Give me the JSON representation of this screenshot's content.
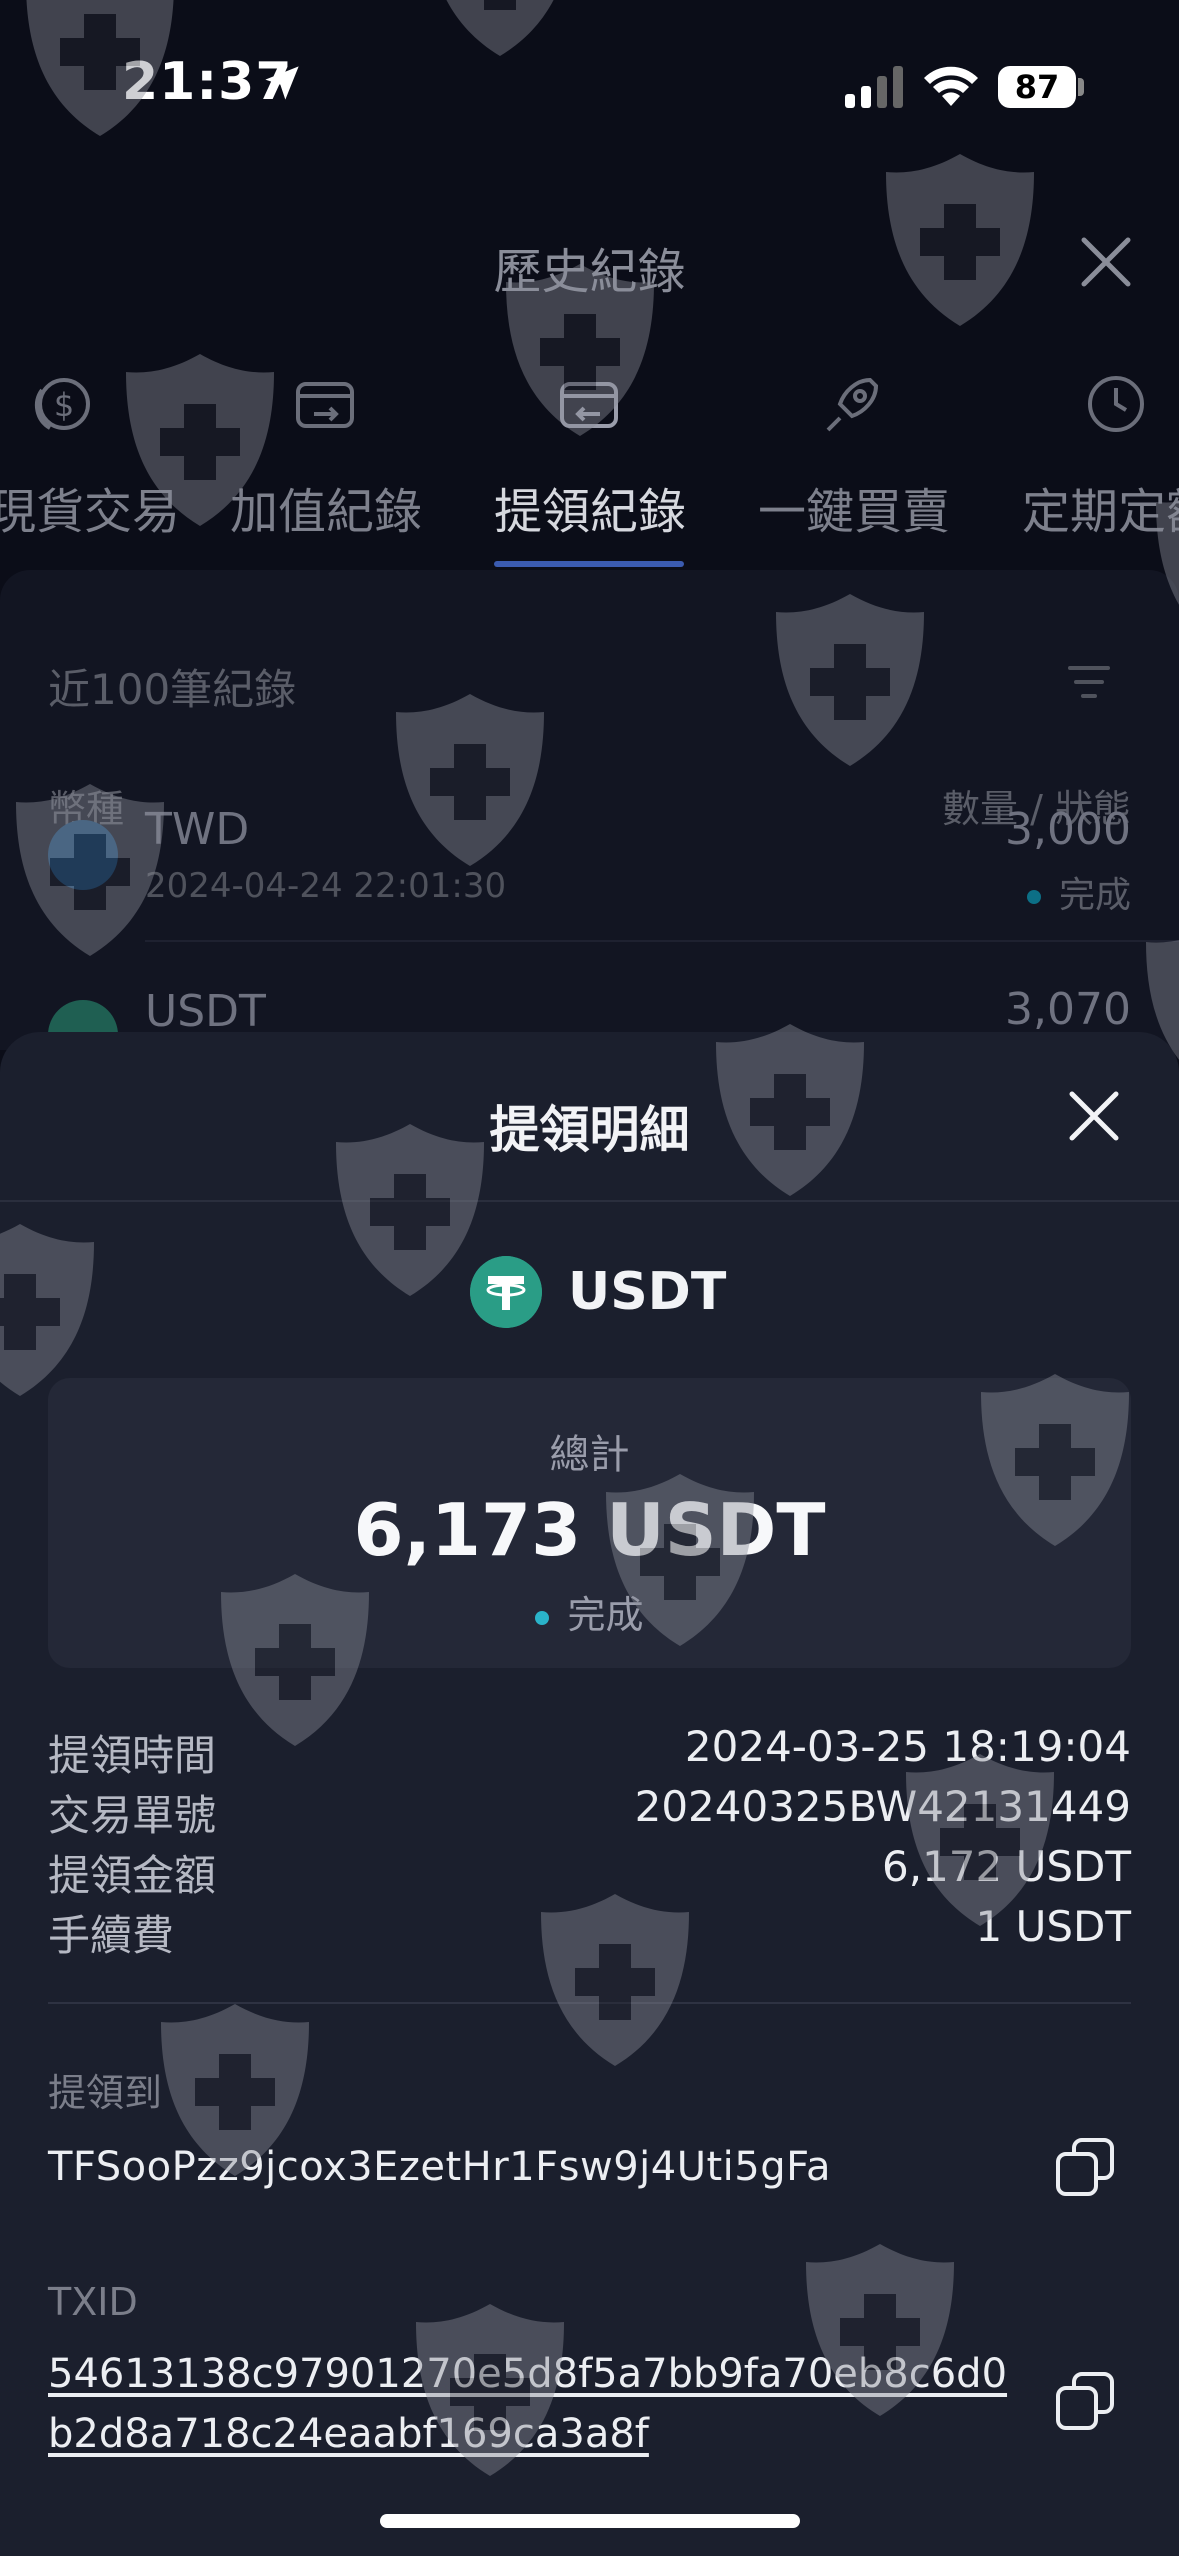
{
  "status_bar": {
    "time": "21:37",
    "battery": "87"
  },
  "header": {
    "title": "歷史紀錄"
  },
  "tabs": [
    {
      "label": "現貨交易",
      "icon": "dollar-coin-icon"
    },
    {
      "label": "加值紀錄",
      "icon": "wallet-in-icon"
    },
    {
      "label": "提領紀錄",
      "icon": "wallet-out-icon",
      "active": true
    },
    {
      "label": "一鍵買賣",
      "icon": "rocket-icon"
    },
    {
      "label": "定期定額",
      "icon": "clock-dollar-icon"
    }
  ],
  "list": {
    "filter_label": "近100筆紀錄",
    "col_left": "幣種",
    "col_right": "數量 / 狀態",
    "rows": [
      {
        "coin": "TWD",
        "date": "2024-04-24 22:01:30",
        "amount": "3,000",
        "status": "完成"
      },
      {
        "coin": "USDT",
        "amount": "3,070"
      }
    ]
  },
  "sheet": {
    "title": "提領明細",
    "coin": "USDT",
    "total_label": "總計",
    "total_amount": "6,173 USDT",
    "status": "完成",
    "details": [
      {
        "label": "提領時間",
        "value": "2024-03-25 18:19:04"
      },
      {
        "label": "交易單號",
        "value": "20240325BW42131449"
      },
      {
        "label": "提領金額",
        "value": "6,172 USDT"
      },
      {
        "label": "手續費",
        "value": "1 USDT"
      }
    ],
    "dest_label": "提領到",
    "dest_address": "TFSooPzz9jcox3EzetHr1Fsw9j4Uti5gFa",
    "txid_label": "TXID",
    "txid": "54613138c97901270e5d8f5a7bb9fa70eb8c6d0b2d8a718c24eaabf169ca3a8f"
  },
  "colors": {
    "accent": "#3b5bb0",
    "usdt": "#2a9d86",
    "status_dot": "#2ab3c9"
  }
}
